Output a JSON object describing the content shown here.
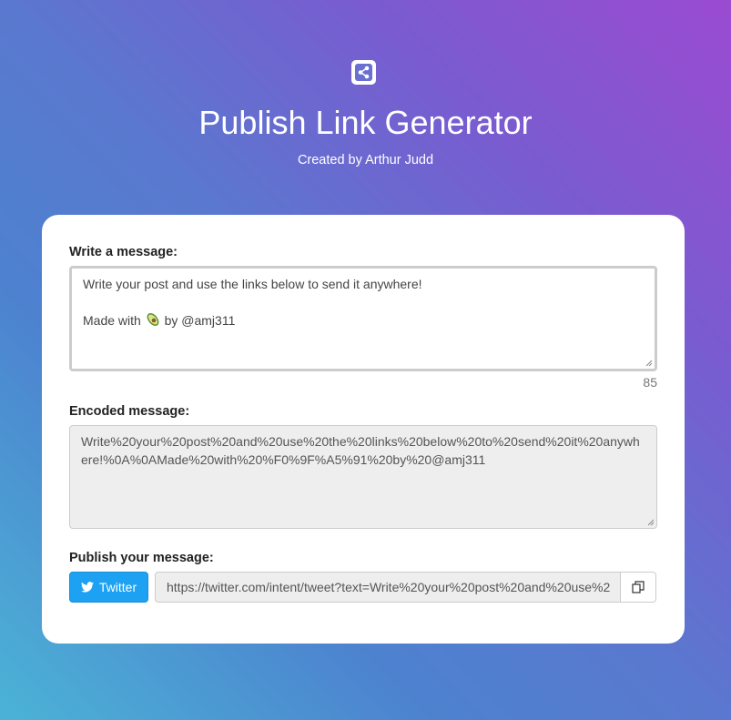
{
  "header": {
    "logo_icon": "share-icon",
    "title": "Publish Link Generator",
    "subtitle": "Created by Arthur Judd"
  },
  "compose": {
    "label": "Write a message:",
    "message_line1": "Write your post and use the links below to send it anywhere!",
    "message_line3_prefix": "Made with ",
    "message_emoji": "avocado-emoji",
    "message_line3_suffix": " by @amj311",
    "char_count": "85"
  },
  "encoded": {
    "label": "Encoded message:",
    "value": "Write%20your%20post%20and%20use%20the%20links%20below%20to%20send%20it%20anywhere!%0A%0AMade%20with%20%F0%9F%A5%91%20by%20@amj311"
  },
  "publish": {
    "label": "Publish your message:",
    "twitter_label": "Twitter",
    "twitter_icon": "twitter-icon",
    "twitter_color": "#1da1f2",
    "url_value": "https://twitter.com/intent/tweet?text=Write%20your%20post%20and%20use%2",
    "copy_icon": "copy-icon"
  }
}
